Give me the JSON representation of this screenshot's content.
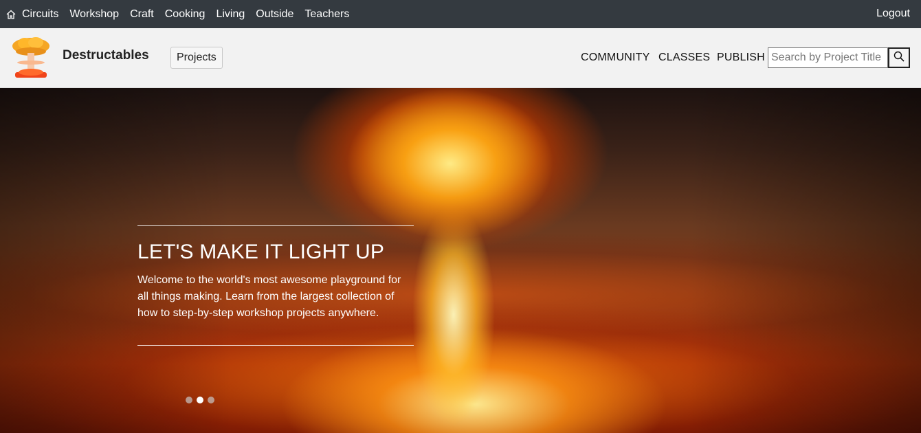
{
  "topbar": {
    "home_icon": "home-icon",
    "categories": [
      "Circuits",
      "Workshop",
      "Craft",
      "Cooking",
      "Living",
      "Outside",
      "Teachers"
    ],
    "logout": "Logout"
  },
  "header": {
    "logo_icon": "mushroom-cloud-logo",
    "brand": "Destructables",
    "projects_button": "Projects",
    "nav": [
      "COMMUNITY",
      "CLASSES",
      "PUBLISH"
    ],
    "search": {
      "placeholder": "Search by Project Title",
      "value": "",
      "icon": "search-icon"
    }
  },
  "hero": {
    "title": "LET'S MAKE IT LIGHT UP",
    "text": "Welcome to the world's most awesome playground for all things making. Learn from the largest collection of how to step-by-step workshop projects anywhere.",
    "carousel": {
      "slides": 3,
      "active_index": 1
    }
  },
  "colors": {
    "topbar": "#343a40",
    "header": "#f2f2f2"
  }
}
